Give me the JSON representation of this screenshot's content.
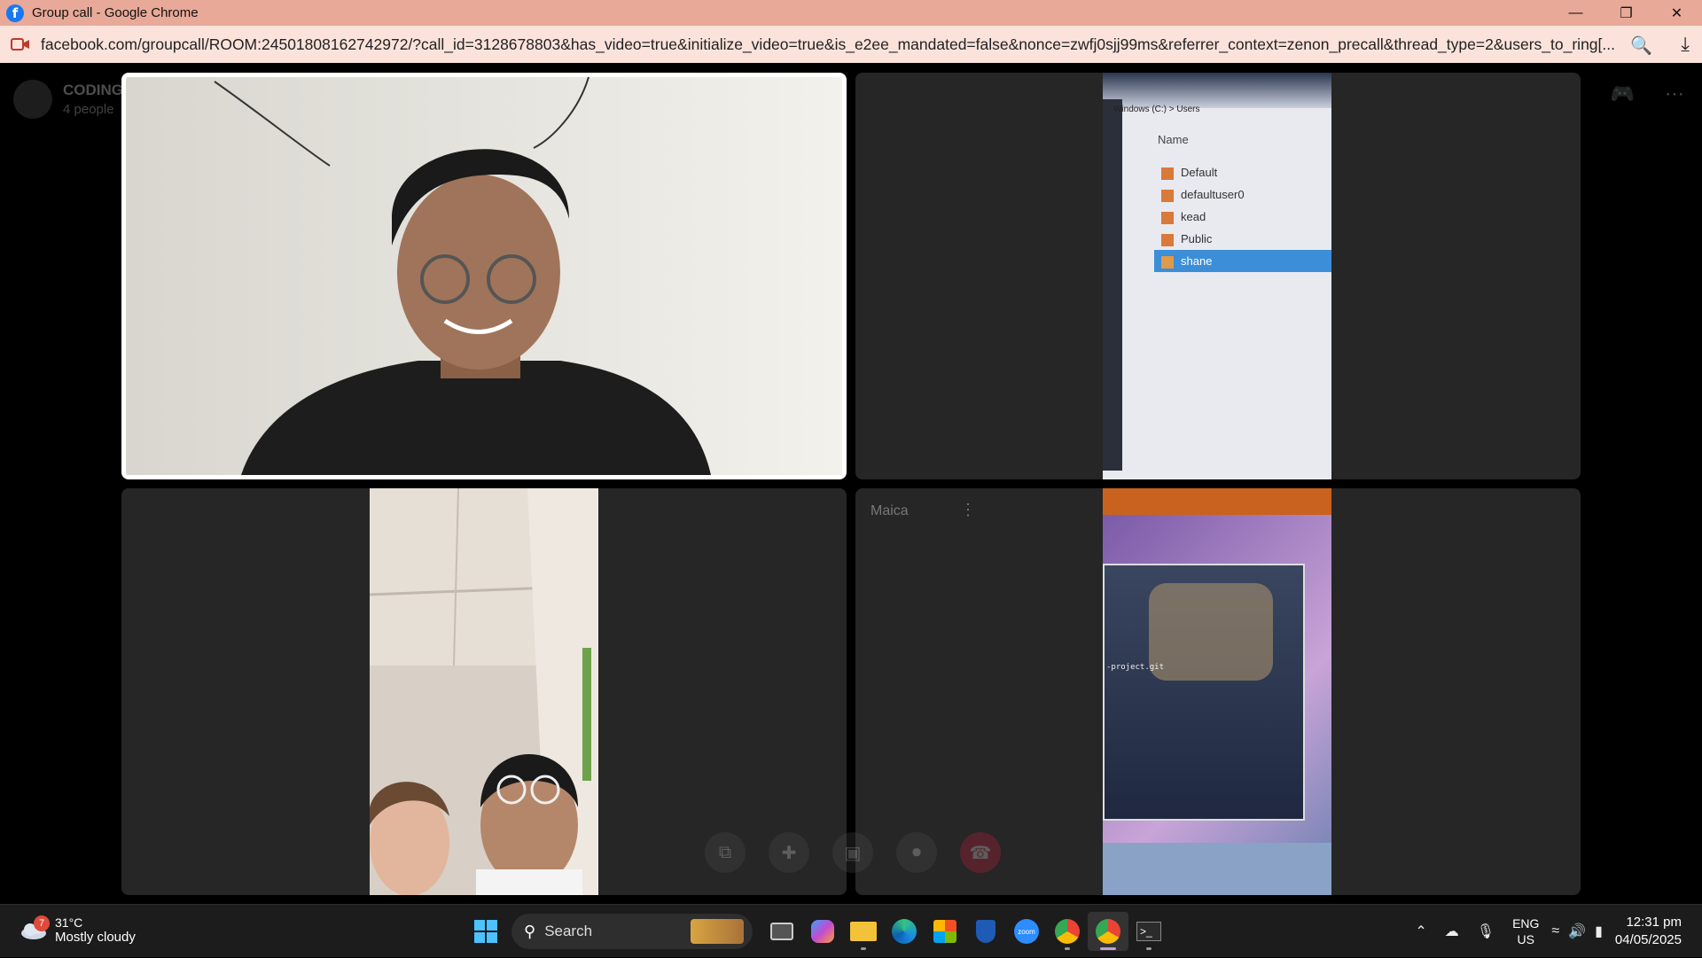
{
  "window": {
    "title": "Group call - Google Chrome",
    "minimize_icon": "minimize-icon",
    "restore_icon": "restore-icon",
    "close_icon": "close-icon"
  },
  "addressbar": {
    "url": "facebook.com/groupcall/ROOM:24501808162742972/?call_id=3128678803&has_video=true&initialize_video=true&is_e2ee_mandated=false&nonce=zwfj0sjj99ms&referrer_context=zenon_precall&thread_type=2&users_to_ring[..."
  },
  "call": {
    "group_name": "CODING PROJ",
    "participants": "4 people",
    "tiles": [
      {
        "id": "participant-1",
        "label": ""
      },
      {
        "id": "participant-2",
        "label": ""
      },
      {
        "id": "participant-3",
        "label": ""
      },
      {
        "id": "participant-4",
        "label": "Maica"
      }
    ],
    "screen_share_text": {
      "path": "Windows (C:) > Users",
      "column": "Name",
      "folders": [
        "Default",
        "defaultuser0",
        "kead",
        "Public",
        "shane"
      ],
      "terminal_line1": "-project.git"
    }
  },
  "taskbar": {
    "weather": {
      "temp": "31°C",
      "condition": "Mostly cloudy",
      "badge": "7"
    },
    "search_label": "Search",
    "lang_1": "ENG",
    "lang_2": "US",
    "time": "12:31 pm",
    "date": "04/05/2025"
  }
}
